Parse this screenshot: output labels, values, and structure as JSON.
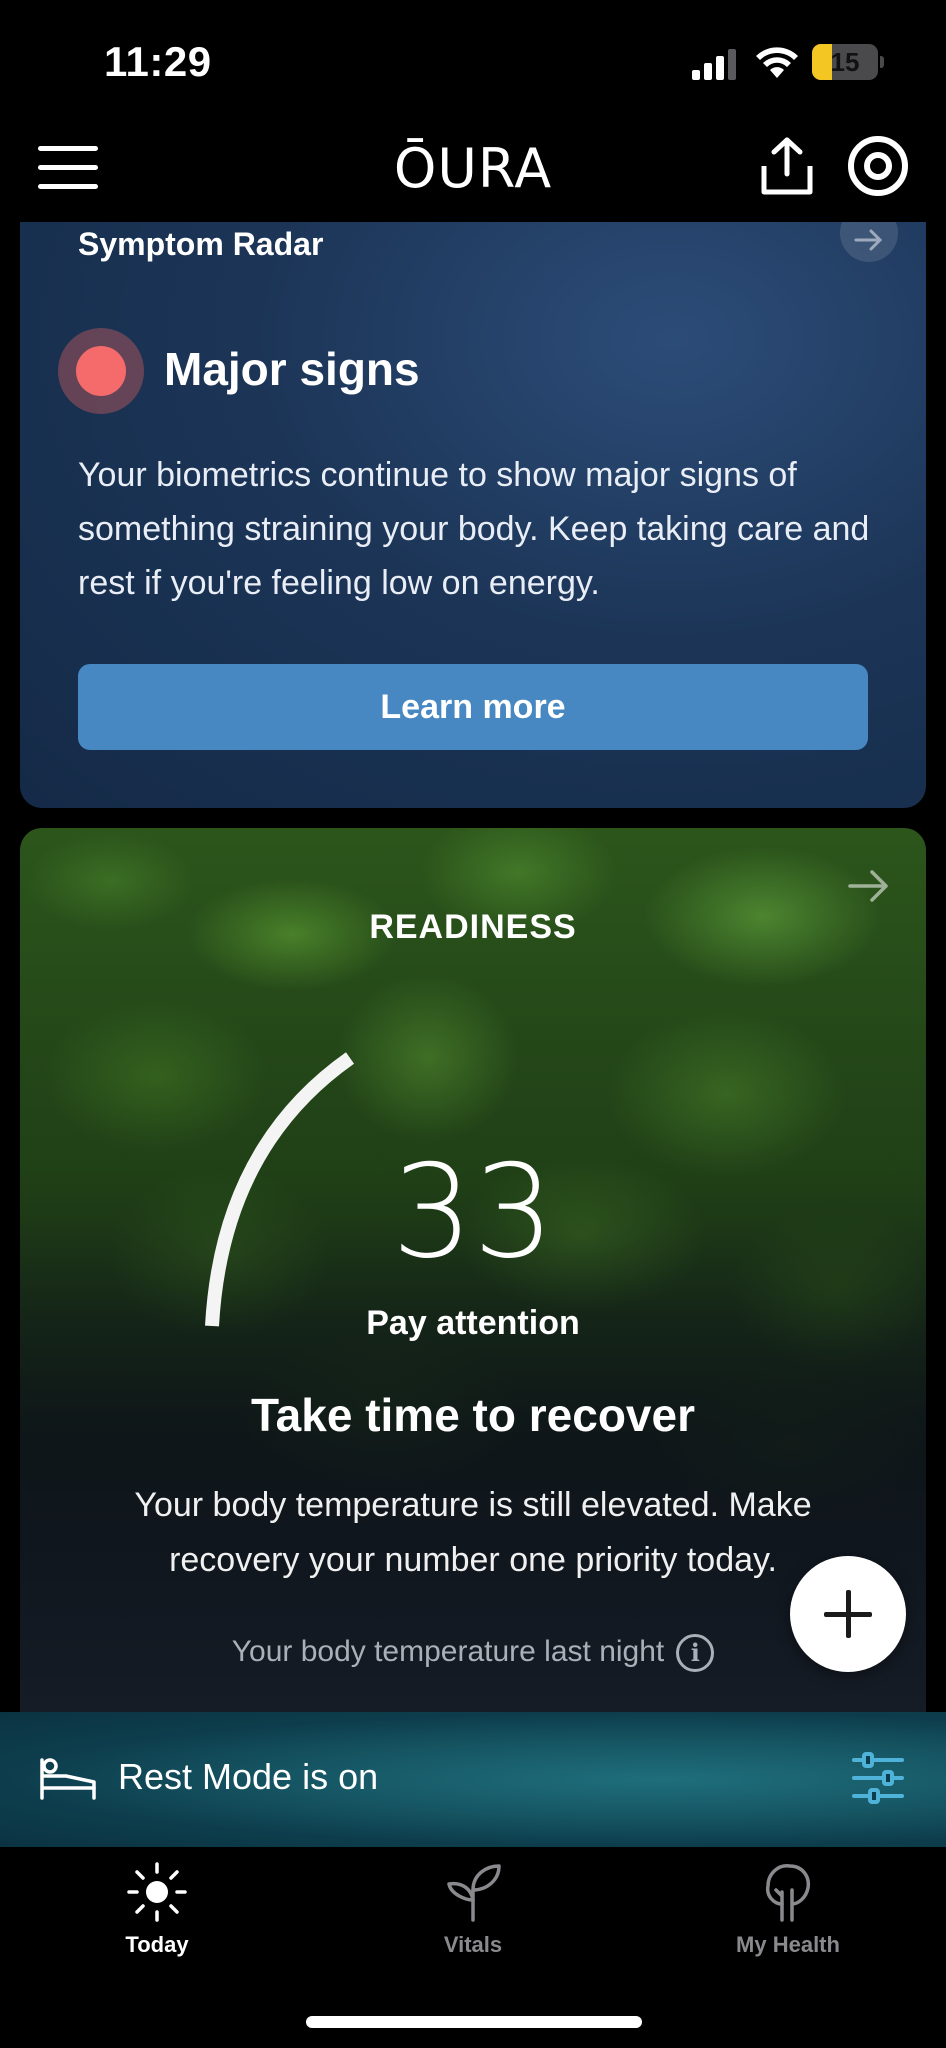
{
  "status_bar": {
    "time": "11:29",
    "battery": "15",
    "battery_level": 0.15
  },
  "header": {
    "logo": "ŌURA"
  },
  "symptom_radar": {
    "title": "Symptom Radar",
    "status": "Major signs",
    "status_color": "#f56b6b",
    "description": "Your biometrics continue to show major signs of something straining your body. Keep taking care and rest if you're feeling low on energy.",
    "button_label": "Learn more",
    "button_color": "#4788c2"
  },
  "readiness": {
    "title": "READINESS",
    "score": "33",
    "score_value": 33,
    "score_label": "Pay attention",
    "headline": "Take time to recover",
    "description": "Your body temperature is still elevated. Make recovery your number one priority today.",
    "temperature_link": "Your body temperature last night"
  },
  "rest_mode": {
    "label": "Rest Mode is on"
  },
  "tabs": [
    {
      "label": "Today",
      "active": true,
      "icon": "sun-icon"
    },
    {
      "label": "Vitals",
      "active": false,
      "icon": "sprout-icon"
    },
    {
      "label": "My Health",
      "active": false,
      "icon": "tree-icon"
    }
  ],
  "colors": {
    "active_tab": "#ffffff",
    "inactive_tab": "#8a8a8e",
    "accent_teal": "#4fb3d9"
  }
}
